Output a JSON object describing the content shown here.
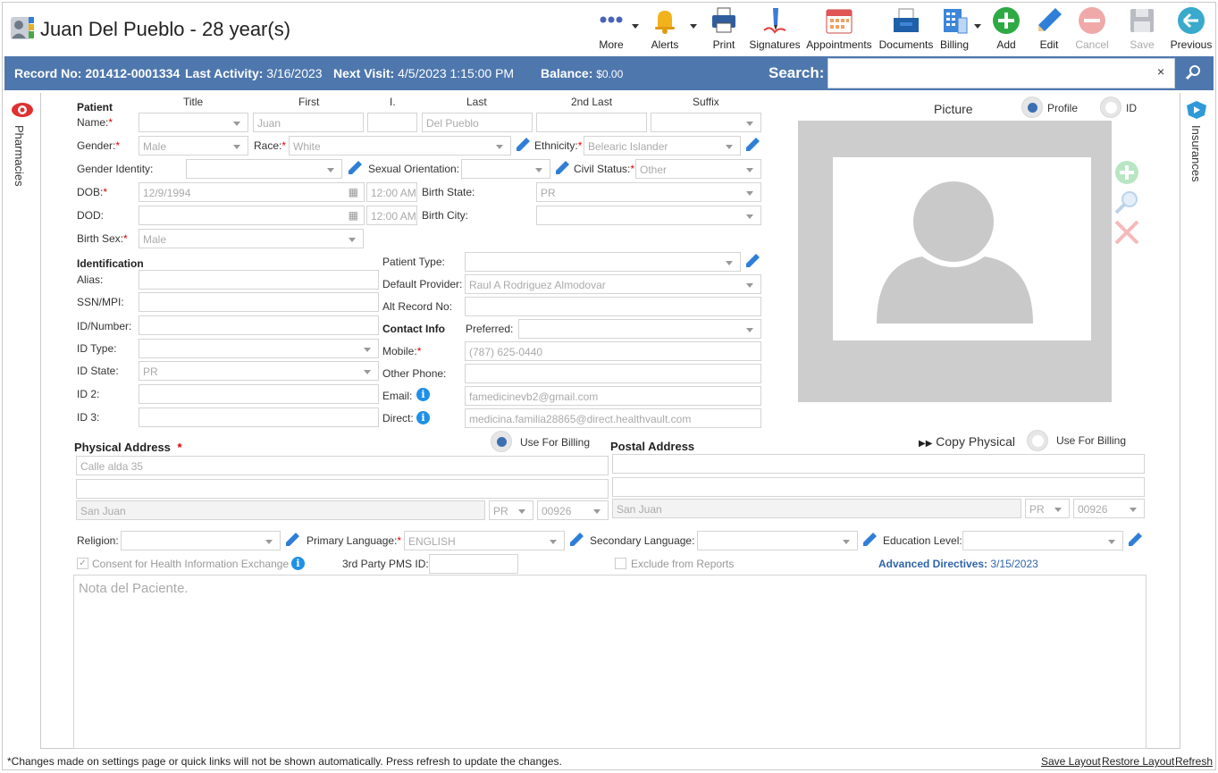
{
  "header": {
    "title": "Juan Del Pueblo - 28 year(s)",
    "toolbar": [
      "More",
      "Alerts",
      "Print",
      "Signatures",
      "Appointments",
      "Documents",
      "Billing",
      "Add",
      "Edit",
      "Cancel",
      "Save",
      "Previous"
    ]
  },
  "bar": {
    "record_label": "Record No:",
    "record_value": "201412-0001334",
    "activity_label": "Last Activity:",
    "activity_value": "3/16/2023",
    "visit_label": "Next Visit:",
    "visit_value": "4/5/2023 1:15:00 PM",
    "balance_label": "Balance:",
    "balance_value": "$0.00",
    "search_label": "Search:",
    "search_value": "",
    "clear": "×"
  },
  "side": {
    "left": "Pharmacies",
    "right": "Insurances"
  },
  "patient": {
    "section": "Patient",
    "col_title": "Title",
    "col_first": "First",
    "col_i": "I.",
    "col_last": "Last",
    "col_2nd_last": "2nd Last",
    "col_suffix": "Suffix",
    "name_label": "Name:",
    "first": "Juan",
    "last": "Del Pueblo",
    "gender_label": "Gender:",
    "gender": "Male",
    "race_label": "Race:",
    "race": "White",
    "ethnicity_label": "Ethnicity:",
    "ethnicity": "Belearic Islander",
    "gender_identity_label": "Gender Identity:",
    "sexual_orientation_label": "Sexual Orientation:",
    "civil_status_label": "Civil Status:",
    "civil_status": "Other",
    "dob_label": "DOB:",
    "dob": "12/9/1994",
    "dob_time": "12:00 AM",
    "birth_state_label": "Birth State:",
    "birth_state": "PR",
    "dod_label": "DOD:",
    "dod_time": "12:00 AM",
    "birth_city_label": "Birth City:",
    "birth_sex_label": "Birth Sex:",
    "birth_sex": "Male"
  },
  "identification": {
    "section": "Identification",
    "alias_label": "Alias:",
    "ssn_label": "SSN/MPI:",
    "id_number_label": "ID/Number:",
    "id_type_label": "ID Type:",
    "id_state_label": "ID State:",
    "id_state": "PR",
    "id2_label": "ID 2:",
    "id3_label": "ID 3:"
  },
  "info": {
    "patient_type_label": "Patient Type:",
    "default_provider_label": "Default Provider:",
    "default_provider": "Raul A Rodriguez Almodovar",
    "alt_record_label": "Alt Record No:",
    "contact_section": "Contact Info",
    "preferred_label": "Preferred:",
    "mobile_label": "Mobile:",
    "mobile": "(787) 625-0440",
    "other_phone_label": "Other Phone:",
    "email_label": "Email:",
    "email": "famedicinevb2@gmail.com",
    "direct_label": "Direct:",
    "direct": "medicina.familia28865@direct.healthvault.com"
  },
  "picture": {
    "label": "Picture",
    "profile": "Profile",
    "id": "ID"
  },
  "physical": {
    "section": "Physical Address",
    "use_billing": "Use For Billing",
    "line1": "Calle alda 35",
    "city": "San Juan",
    "state": "PR",
    "zip": "00926"
  },
  "postal": {
    "section": "Postal Address",
    "copy": "Copy Physical",
    "use_billing": "Use For Billing",
    "city": "San Juan",
    "state": "PR",
    "zip": "00926"
  },
  "misc": {
    "religion_label": "Religion:",
    "primary_language_label": "Primary Language:",
    "primary_language": "ENGLISH",
    "secondary_language_label": "Secondary Language:",
    "education_label": "Education Level:",
    "consent": "Consent for Health Information Exchange",
    "pms_label": "3rd Party PMS ID:",
    "exclude": "Exclude from Reports",
    "advanced_label": "Advanced Directives:",
    "advanced_value": "3/15/2023",
    "note_placeholder": "Nota del Paciente."
  },
  "footer": {
    "notice": "*Changes made on settings page or quick links will not be shown automatically. Press refresh to update the changes.",
    "save_layout": "Save Layout",
    "restore_layout": "Restore Layout",
    "refresh": "Refresh"
  }
}
